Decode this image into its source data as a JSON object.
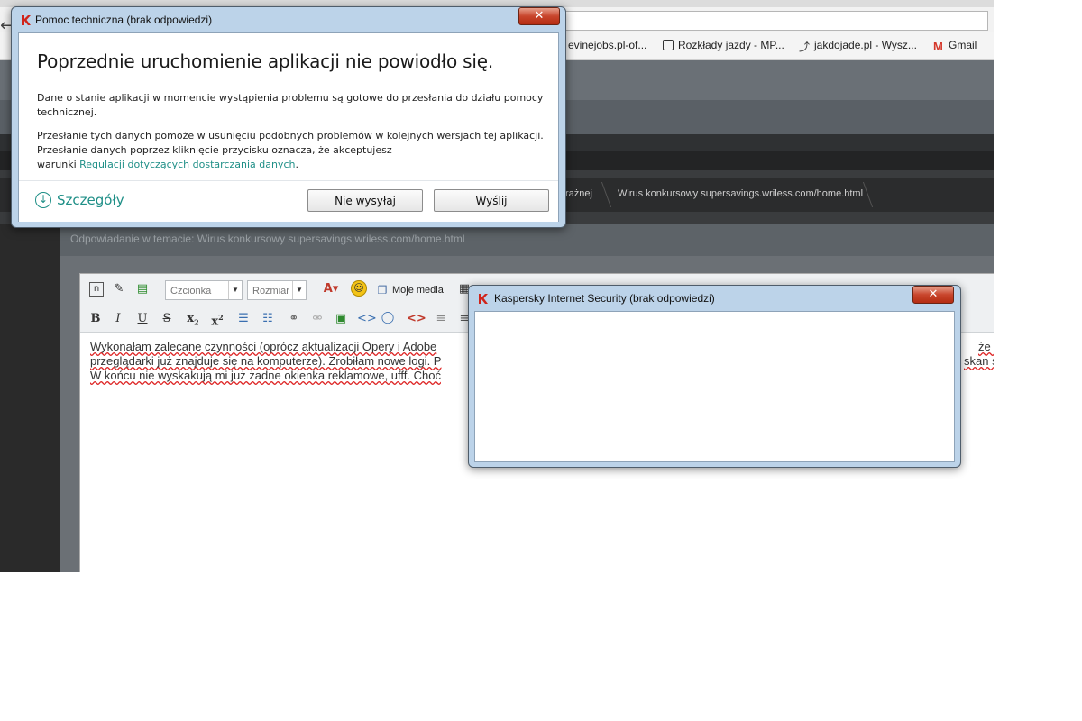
{
  "browser": {
    "bookmarks": [
      {
        "label": "evinejobs.pl-of..."
      },
      {
        "label": "Rozkłady jazdy - MP..."
      },
      {
        "label": "jakdojade.pl - Wysz..."
      },
      {
        "label": "Gmail"
      }
    ],
    "breadcrumbs": [
      "rażnej",
      "Wirus konkursowy supersavings.wriless.com/home.html"
    ],
    "reply_title": "Odpowiadanie w temacie: Wirus konkursowy supersavings.wriless.com/home.html",
    "editor": {
      "font_select": "Czcionka",
      "size_select": "Rozmiar",
      "media_label": "Moje media",
      "text_lines": [
        "Wykonałam zalecane czynności (oprócz aktualizacji Opery i Adobe",
        "przeglądarki już znajduje się na komputerze). Zrobiłam nowe logi. P",
        "W końcu nie wyskakują mi już żadne okienka reklamowe, ufff. Choć"
      ],
      "text_right": [
        "że na",
        "skan s"
      ]
    }
  },
  "dialog_support": {
    "title": "Pomoc techniczna (brak odpowiedzi)",
    "close": "✕",
    "heading": "Poprzednie uruchomienie aplikacji nie powiodło się.",
    "para1_line1": "Dane o stanie aplikacji w momencie wystąpienia problemu są gotowe do przesłania do działu pomocy",
    "para1_line2": "technicznej.",
    "para2_line1": "Przesłanie tych danych pomoże w usunięciu podobnych problemów w kolejnych wersjach tej aplikacji.",
    "para2_line2": "Przesłanie danych poprzez kliknięcie przycisku oznacza, że akceptujesz",
    "para2_line3_prefix": "warunki ",
    "para2_link": "Regulacji dotyczących dostarczania danych",
    "para2_suffix": ".",
    "details_label": "Szczegóły",
    "btn_dont_send": "Nie wysyłaj",
    "btn_send": "Wyślij",
    "accent_color": "#1f8f87"
  },
  "dialog_kis": {
    "title": "Kaspersky Internet Security (brak odpowiedzi)",
    "close": "✕"
  }
}
